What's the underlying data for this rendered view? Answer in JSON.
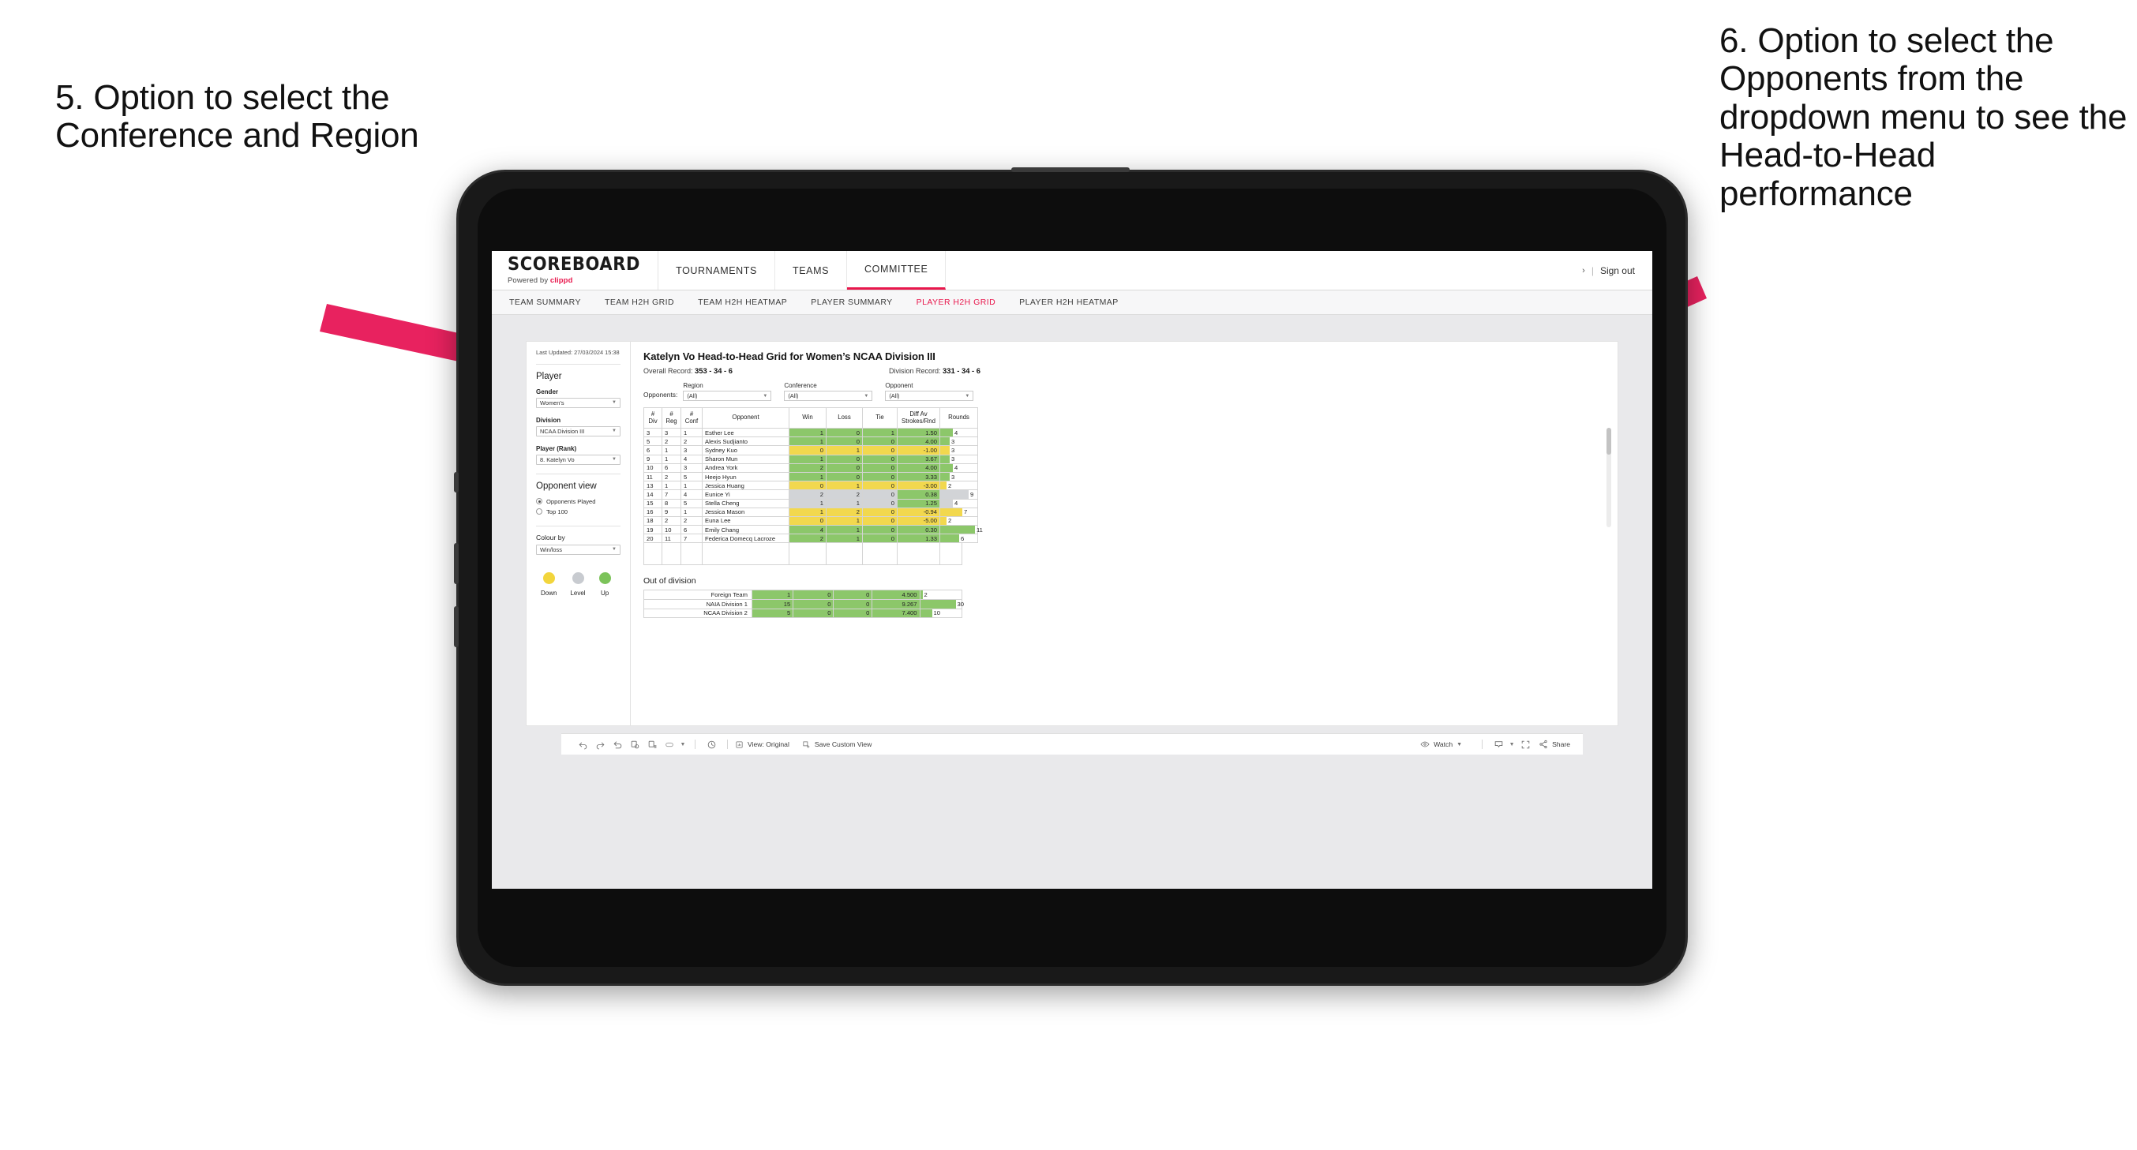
{
  "annotations": {
    "left": "5. Option to select the Conference and Region",
    "right": "6. Option to select the Opponents from the dropdown menu to see the Head-to-Head performance",
    "arrow_color": "#e8225f"
  },
  "app": {
    "brand": {
      "title": "SCOREBOARD",
      "powered_prefix": "Powered by ",
      "powered_brand": "clippd"
    },
    "main_nav": [
      {
        "label": "TOURNAMENTS",
        "active": false
      },
      {
        "label": "TEAMS",
        "active": false
      },
      {
        "label": "COMMITTEE",
        "active": true
      }
    ],
    "header_right": {
      "chevron": "›",
      "divider": "|",
      "sign_out": "Sign out"
    },
    "sub_nav": [
      {
        "label": "TEAM SUMMARY",
        "active": false
      },
      {
        "label": "TEAM H2H GRID",
        "active": false
      },
      {
        "label": "TEAM H2H HEATMAP",
        "active": false
      },
      {
        "label": "PLAYER SUMMARY",
        "active": false
      },
      {
        "label": "PLAYER H2H GRID",
        "active": true
      },
      {
        "label": "PLAYER H2H HEATMAP",
        "active": false
      }
    ]
  },
  "sidebar": {
    "last_updated": "Last Updated: 27/03/2024 15:38",
    "player_heading": "Player",
    "fields": [
      {
        "label": "Gender",
        "value": "Women’s"
      },
      {
        "label": "Division",
        "value": "NCAA Division III"
      },
      {
        "label": "Player (Rank)",
        "value": "8. Katelyn Vo"
      }
    ],
    "opponent_view": {
      "heading": "Opponent view",
      "options": [
        {
          "label": "Opponents Played",
          "selected": true
        },
        {
          "label": "Top 100",
          "selected": false
        }
      ]
    },
    "colour_by": {
      "label": "Colour by",
      "value": "Win/loss"
    },
    "legend": [
      {
        "label": "Down",
        "color": "#f2d53c"
      },
      {
        "label": "Level",
        "color": "#c8cbd0"
      },
      {
        "label": "Up",
        "color": "#7cc35a"
      }
    ]
  },
  "main": {
    "title": "Katelyn Vo Head-to-Head Grid for Women’s NCAA Division III",
    "overall_record_label": "Overall Record: ",
    "overall_record_value": "353 -  34 - 6",
    "division_record_label": "Division Record: ",
    "division_record_value": "331 -  34 - 6",
    "opponents_label": "Opponents:",
    "filters": [
      {
        "name": "Region",
        "value": "(All)"
      },
      {
        "name": "Conference",
        "value": "(All)"
      },
      {
        "name": "Opponent",
        "value": "(All)"
      }
    ]
  },
  "chart_data": {
    "type": "table",
    "title": "Katelyn Vo Head-to-Head Grid for Women’s NCAA Division III",
    "columns": [
      "# Div",
      "# Reg",
      "# Conf",
      "Opponent",
      "Win",
      "Loss",
      "Tie",
      "Diff Av Strokes/Rnd",
      "Rounds"
    ],
    "column_header_lines": [
      [
        "#",
        "Div"
      ],
      [
        "#",
        "Reg"
      ],
      [
        "#",
        "Conf"
      ],
      [
        "Opponent"
      ],
      [
        "Win"
      ],
      [
        "Loss"
      ],
      [
        "Tie"
      ],
      [
        "Diff Av",
        "Strokes/Rnd"
      ],
      [
        "Rounds"
      ]
    ],
    "rounds_max": 12,
    "rows": [
      {
        "div": "3",
        "reg": "3",
        "conf": "1",
        "opponent": "Esther Lee",
        "win": "1",
        "loss": "0",
        "tie": "1",
        "diff": "1.50",
        "rounds": 4,
        "state": "up"
      },
      {
        "div": "5",
        "reg": "2",
        "conf": "2",
        "opponent": "Alexis Sudjianto",
        "win": "1",
        "loss": "0",
        "tie": "0",
        "diff": "4.00",
        "rounds": 3,
        "state": "up"
      },
      {
        "div": "6",
        "reg": "1",
        "conf": "3",
        "opponent": "Sydney Kuo",
        "win": "0",
        "loss": "1",
        "tie": "0",
        "diff": "-1.00",
        "rounds": 3,
        "state": "down"
      },
      {
        "div": "9",
        "reg": "1",
        "conf": "4",
        "opponent": "Sharon Mun",
        "win": "1",
        "loss": "0",
        "tie": "0",
        "diff": "3.67",
        "rounds": 3,
        "state": "up"
      },
      {
        "div": "10",
        "reg": "6",
        "conf": "3",
        "opponent": "Andrea York",
        "win": "2",
        "loss": "0",
        "tie": "0",
        "diff": "4.00",
        "rounds": 4,
        "state": "up"
      },
      {
        "div": "11",
        "reg": "2",
        "conf": "5",
        "opponent": "Heejo Hyun",
        "win": "1",
        "loss": "0",
        "tie": "0",
        "diff": "3.33",
        "rounds": 3,
        "state": "up"
      },
      {
        "div": "13",
        "reg": "1",
        "conf": "1",
        "opponent": "Jessica Huang",
        "win": "0",
        "loss": "1",
        "tie": "0",
        "diff": "-3.00",
        "rounds": 2,
        "state": "down"
      },
      {
        "div": "14",
        "reg": "7",
        "conf": "4",
        "opponent": "Eunice Yi",
        "win": "2",
        "loss": "2",
        "tie": "0",
        "diff": "0.38",
        "rounds": 9,
        "state": "level",
        "diff_state": "up"
      },
      {
        "div": "15",
        "reg": "8",
        "conf": "5",
        "opponent": "Stella Cheng",
        "win": "1",
        "loss": "1",
        "tie": "0",
        "diff": "1.25",
        "rounds": 4,
        "state": "level",
        "diff_state": "up"
      },
      {
        "div": "16",
        "reg": "9",
        "conf": "1",
        "opponent": "Jessica Mason",
        "win": "1",
        "loss": "2",
        "tie": "0",
        "diff": "-0.94",
        "rounds": 7,
        "state": "down"
      },
      {
        "div": "18",
        "reg": "2",
        "conf": "2",
        "opponent": "Euna Lee",
        "win": "0",
        "loss": "1",
        "tie": "0",
        "diff": "-5.00",
        "rounds": 2,
        "state": "down"
      },
      {
        "div": "19",
        "reg": "10",
        "conf": "6",
        "opponent": "Emily Chang",
        "win": "4",
        "loss": "1",
        "tie": "0",
        "diff": "0.30",
        "rounds": 11,
        "state": "up"
      },
      {
        "div": "20",
        "reg": "11",
        "conf": "7",
        "opponent": "Federica Domecq Lacroze",
        "win": "2",
        "loss": "1",
        "tie": "0",
        "diff": "1.33",
        "rounds": 6,
        "state": "up"
      }
    ]
  },
  "out_of_division": {
    "heading": "Out of division",
    "rounds_max": 32,
    "rows": [
      {
        "name": "Foreign Team",
        "win": "1",
        "loss": "0",
        "tie": "0",
        "diff": "4.500",
        "rounds": 2,
        "state": "up"
      },
      {
        "name": "NAIA Division 1",
        "win": "15",
        "loss": "0",
        "tie": "0",
        "diff": "9.267",
        "rounds": 30,
        "state": "up"
      },
      {
        "name": "NCAA Division 2",
        "win": "5",
        "loss": "0",
        "tie": "0",
        "diff": "7.400",
        "rounds": 10,
        "state": "up"
      }
    ]
  },
  "toolbar": {
    "view_label": "View: Original",
    "save_label": "Save Custom View",
    "watch_label": "Watch",
    "share_label": "Share"
  }
}
